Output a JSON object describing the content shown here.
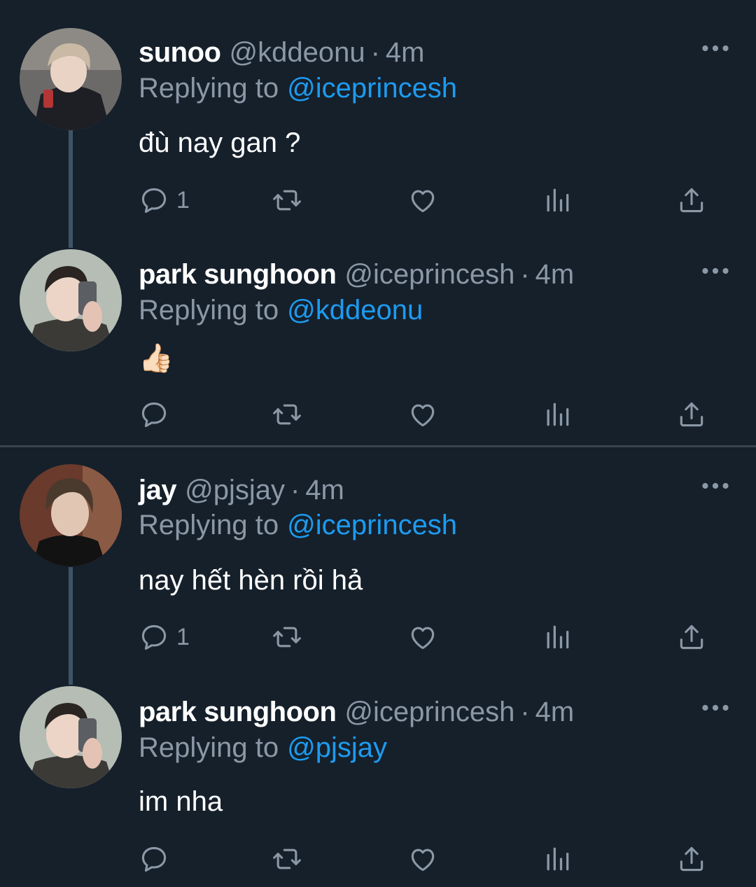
{
  "colors": {
    "background": "#15202b",
    "secondary_text": "#8b98a5",
    "mention": "#1d9bf0",
    "divider": "#38444d"
  },
  "tweets": [
    {
      "name": "sunoo",
      "handle": "@kddeonu",
      "separator": "·",
      "time": "4m",
      "reply_prefix": "Replying to",
      "reply_to": "@iceprincesh",
      "text": "đù nay gan ?",
      "reply_count": "1"
    },
    {
      "name": "park sunghoon",
      "handle": "@iceprincesh",
      "separator": "·",
      "time": "4m",
      "reply_prefix": "Replying to",
      "reply_to": "@kddeonu",
      "text": "👍🏻",
      "reply_count": ""
    },
    {
      "name": "jay",
      "handle": "@pjsjay",
      "separator": "·",
      "time": "4m",
      "reply_prefix": "Replying to",
      "reply_to": "@iceprincesh",
      "text": "nay hết hèn rồi hả",
      "reply_count": "1"
    },
    {
      "name": "park sunghoon",
      "handle": "@iceprincesh",
      "separator": "·",
      "time": "4m",
      "reply_prefix": "Replying to",
      "reply_to": "@pjsjay",
      "text": "im nha",
      "reply_count": ""
    }
  ],
  "icons": {
    "more": "more-horizontal-icon",
    "reply": "reply-icon",
    "retweet": "retweet-icon",
    "like": "heart-icon",
    "views": "views-icon",
    "share": "share-icon"
  }
}
